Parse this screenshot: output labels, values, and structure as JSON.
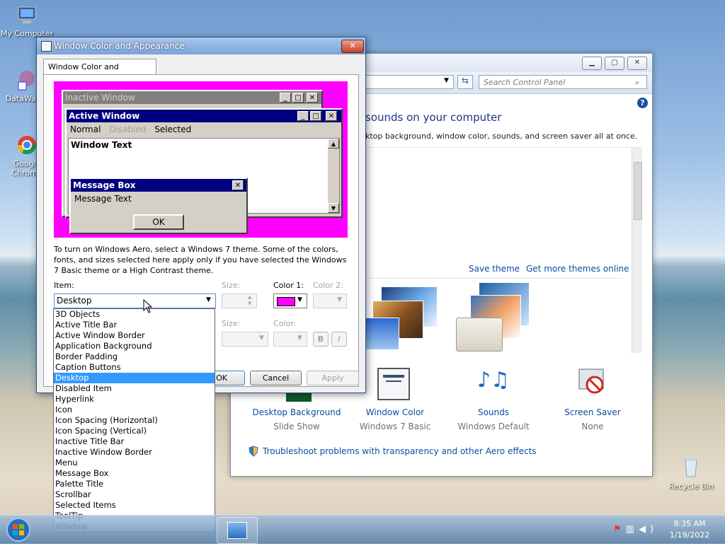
{
  "desktop": {
    "icons": [
      {
        "label": "My Computer"
      },
      {
        "label": "DataWag..."
      },
      {
        "label": "Google Chrome"
      },
      {
        "label": "Recycle Bin"
      }
    ]
  },
  "control_panel": {
    "search_placeholder": "Search Control Panel",
    "heading": "sounds on your computer",
    "subtext": "ktop background, window color, sounds, and screen saver all at once.",
    "save_theme": "Save theme",
    "get_more_themes": "Get more themes online",
    "tiles": [
      {
        "label": "Desktop Background",
        "sub": "Slide Show"
      },
      {
        "label": "Window Color",
        "sub": "Windows 7 Basic"
      },
      {
        "label": "Sounds",
        "sub": "Windows Default"
      },
      {
        "label": "Screen Saver",
        "sub": "None"
      }
    ],
    "troubleshoot": "Troubleshoot problems with transparency and other Aero effects"
  },
  "dialog": {
    "title": "Window Color and Appearance",
    "tab": "Window Color and Appearance",
    "preview": {
      "inactive_title": "Inactive Window",
      "active_title": "Active Window",
      "menu_normal": "Normal",
      "menu_disabled": "Disabled",
      "menu_selected": "Selected",
      "window_text": "Window Text",
      "msgbox_title": "Message Box",
      "msgbox_text": "Message Text",
      "ok": "OK"
    },
    "description": "To turn on Windows Aero, select a Windows 7 theme.  Some of the colors, fonts, and sizes selected here apply only if you have selected the Windows 7 Basic theme or a High Contrast theme.",
    "item_label": "Item:",
    "size_label": "Size:",
    "color1_label": "Color 1:",
    "color2_label": "Color 2:",
    "font_size_label": "Size:",
    "font_color_label": "Color:",
    "bold_label": "B",
    "italic_label": "I",
    "selected_item": "Desktop",
    "ok": "OK",
    "cancel": "Cancel",
    "apply": "Apply",
    "color1_value": "#ff00ff",
    "items": [
      "3D Objects",
      "Active Title Bar",
      "Active Window Border",
      "Application Background",
      "Border Padding",
      "Caption Buttons",
      "Desktop",
      "Disabled Item",
      "Hyperlink",
      "Icon",
      "Icon Spacing (Horizontal)",
      "Icon Spacing (Vertical)",
      "Inactive Title Bar",
      "Inactive Window Border",
      "Menu",
      "Message Box",
      "Palette Title",
      "Scrollbar",
      "Selected Items",
      "ToolTip",
      "Window"
    ]
  },
  "taskbar": {
    "time": "8:35 AM",
    "date": "1/19/2022"
  }
}
